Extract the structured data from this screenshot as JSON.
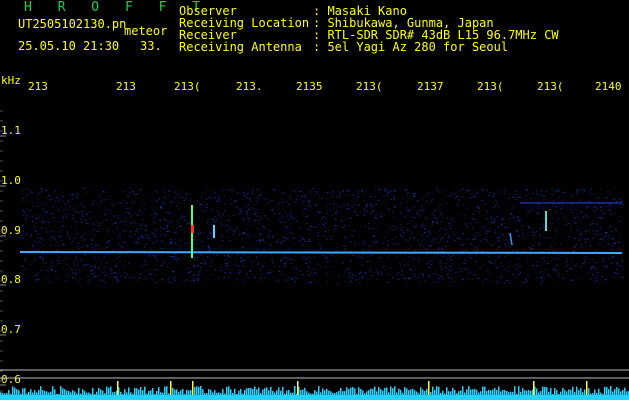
{
  "header": {
    "brand": "H R O F F T",
    "filename": "UT2505102130.pn",
    "tag": "meteor",
    "datetime": "25.05.10 21:30",
    "count": "33.",
    "fields": [
      {
        "label": "Observer",
        "value": ": Masaki Kano"
      },
      {
        "label": "Receiving Location",
        "value": ": Shibukawa, Gunma, Japan"
      },
      {
        "label": "Receiver",
        "value": ": RTL-SDR SDR# 43dB L15 96.7MHz CW"
      },
      {
        "label": "Receiving Antenna",
        "value": ": 5el Yagi Az 280 for Seoul"
      }
    ]
  },
  "time_axis": {
    "labels": [
      "213",
      "213",
      "213(",
      "213.",
      "2135",
      "213(",
      "2137",
      "213(",
      "213(",
      "2140"
    ]
  },
  "freq_axis": {
    "unit": "kHz",
    "labels": [
      "1.1",
      "1.0",
      "0.9",
      "0.8",
      "0.7",
      "0.6"
    ]
  },
  "colors": {
    "text": "#ffff00",
    "brand": "#22cc44",
    "carrier": "#3fa8ff",
    "noise": "#1f3bd6",
    "hline": "#bbbbbb",
    "baseline": "#22d3ff",
    "spike": "#ffff33"
  }
}
